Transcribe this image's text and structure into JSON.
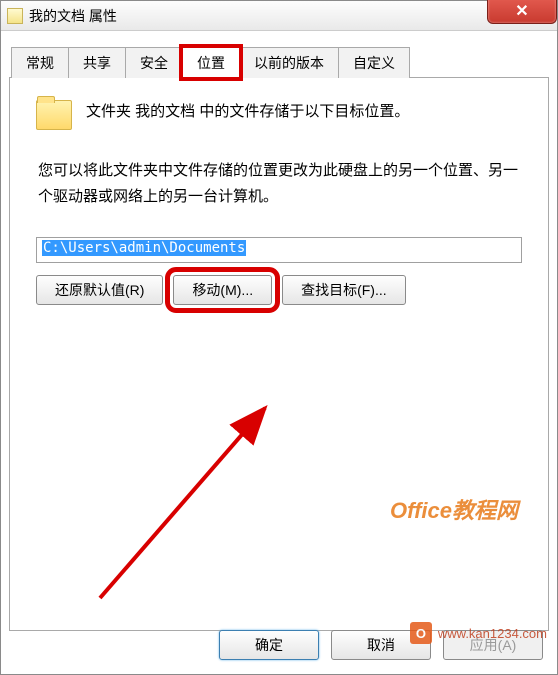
{
  "title": "我的文档 属性",
  "tabs": [
    {
      "label": "常规"
    },
    {
      "label": "共享"
    },
    {
      "label": "安全"
    },
    {
      "label": "位置",
      "active": true,
      "highlight": true
    },
    {
      "label": "以前的版本"
    },
    {
      "label": "自定义"
    }
  ],
  "panel": {
    "desc1": "文件夹 我的文档 中的文件存储于以下目标位置。",
    "desc2": "您可以将此文件夹中文件存储的位置更改为此硬盘上的另一个位置、另一个驱动器或网络上的另一台计算机。",
    "path_value": "C:\\Users\\admin\\Documents",
    "restore_btn": "还原默认值(R)",
    "move_btn": "移动(M)...",
    "find_btn": "查找目标(F)..."
  },
  "dialog": {
    "ok": "确定",
    "cancel": "取消",
    "apply": "应用(A)"
  },
  "watermark": {
    "text1": "Office教程网",
    "text2": "www.kan1234.com",
    "badge": "O"
  }
}
